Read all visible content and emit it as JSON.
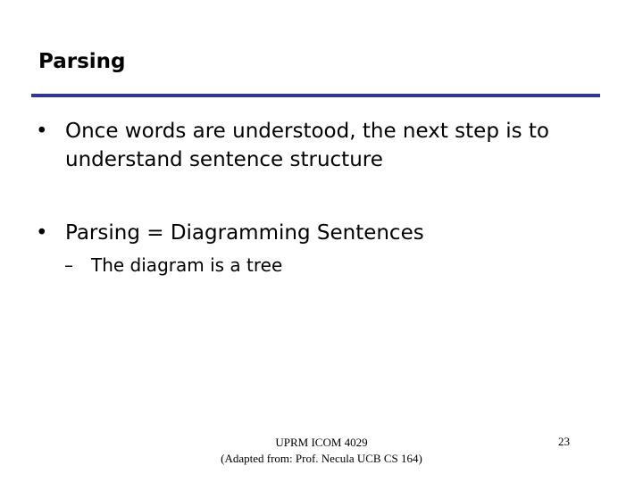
{
  "slide": {
    "title": "Parsing",
    "rule_color": "#3333a0",
    "bullets": [
      {
        "marker": "•",
        "lines": [
          "Once words are understood, the next step is to",
          "understand sentence structure"
        ]
      },
      {
        "marker": "•",
        "lines": [
          "Parsing = Diagramming Sentences"
        ],
        "sub_bullets": [
          {
            "marker": "–",
            "text": "The diagram is a tree"
          }
        ]
      }
    ],
    "footer": {
      "line1": "UPRM ICOM 4029",
      "line2": "(Adapted from: Prof. Necula  UCB  CS 164)",
      "page_number": "23"
    }
  }
}
